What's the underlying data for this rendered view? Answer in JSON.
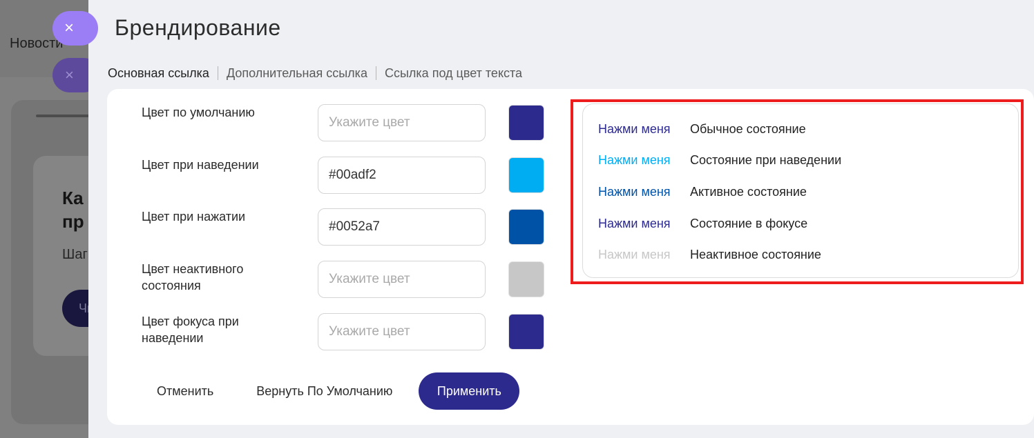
{
  "background": {
    "nav_item": "Новости",
    "card_title": "Ка\nпр",
    "card_subtitle": "Шаг",
    "card_button": "Чи"
  },
  "close_icon": "×",
  "modal": {
    "title": "Брендирование",
    "tabs": [
      {
        "label": "Основная ссылка",
        "active": true
      },
      {
        "label": "Дополнительная ссылка",
        "active": false
      },
      {
        "label": "Ссылка под цвет текста",
        "active": false
      }
    ],
    "rows": [
      {
        "label": "Цвет по умолчанию",
        "value": "",
        "placeholder": "Укажите цвет",
        "swatch": "#2d2a8e"
      },
      {
        "label": "Цвет при наведении",
        "value": "#00adf2",
        "placeholder": "Укажите цвет",
        "swatch": "#00adf2"
      },
      {
        "label": "Цвет при нажатии",
        "value": "#0052a7",
        "placeholder": "Укажите цвет",
        "swatch": "#0052a7"
      },
      {
        "label": "Цвет неактивного состояния",
        "value": "",
        "placeholder": "Укажите цвет",
        "swatch": "#c7c7c7"
      },
      {
        "label": "Цвет фокуса при наведении",
        "value": "",
        "placeholder": "Укажите цвет",
        "swatch": "#2d2a8e"
      }
    ],
    "actions": {
      "cancel": "Отменить",
      "reset": "Вернуть По Умолчанию",
      "apply": "Применить"
    },
    "preview": [
      {
        "link": "Нажми меня",
        "desc": "Обычное состояние",
        "color": "#2d2a8e"
      },
      {
        "link": "Нажми меня",
        "desc": "Состояние при наведении",
        "color": "#00adf2"
      },
      {
        "link": "Нажми меня",
        "desc": "Активное состояние",
        "color": "#0052a7"
      },
      {
        "link": "Нажми меня",
        "desc": "Состояние в фокусе",
        "color": "#2d2a8e"
      },
      {
        "link": "Нажми меня",
        "desc": "Неактивное состояние",
        "color": "#c7c7c7"
      }
    ],
    "highlight_color": "#ee1c1c"
  }
}
